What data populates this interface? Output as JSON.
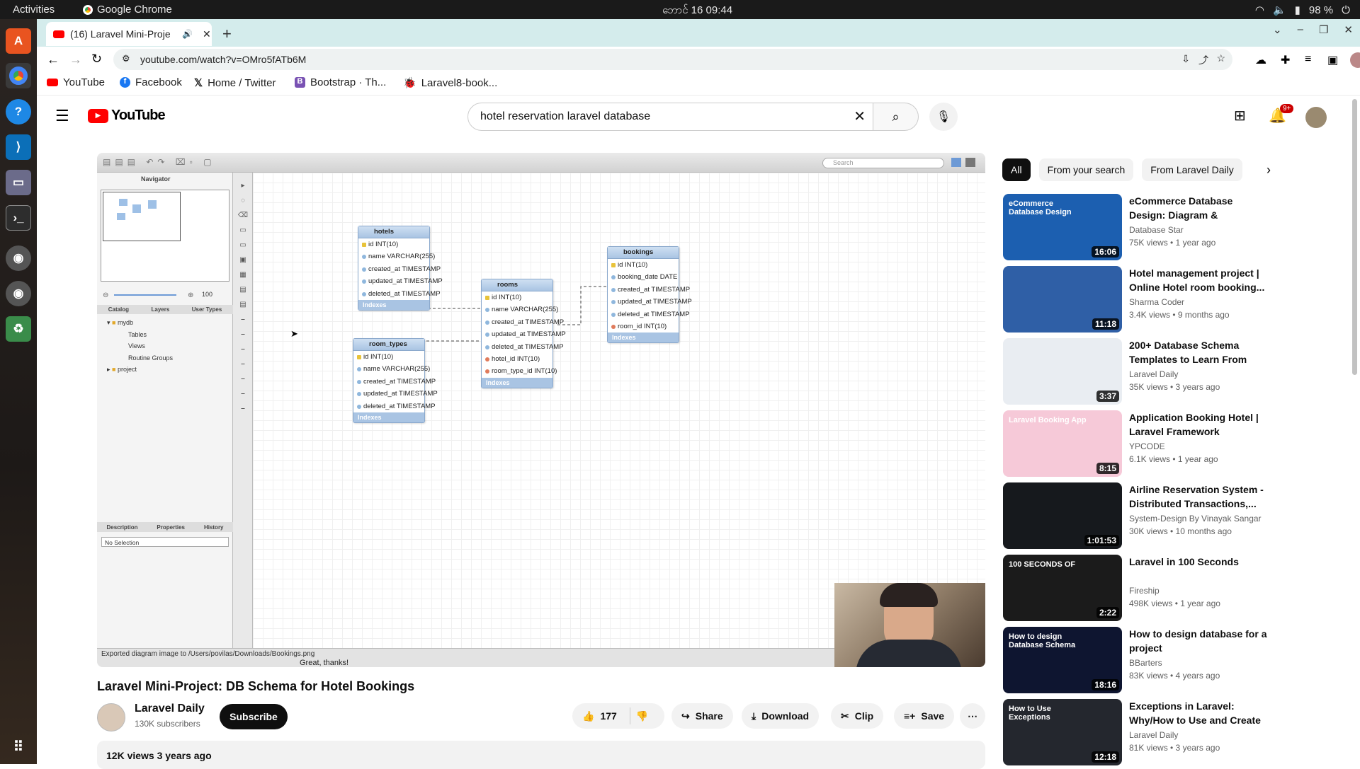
{
  "system": {
    "activities": "Activities",
    "app_name": "Google Chrome",
    "clock": "ဘောင် 16  09:44",
    "battery": "98 %"
  },
  "browser": {
    "tab_title": "(16) Laravel Mini-Proje",
    "url": "youtube.com/watch?v=OMro5fATb6M",
    "bookmarks": [
      "YouTube",
      "Facebook",
      "Home / Twitter",
      "Bootstrap · Th...",
      "Laravel8-book..."
    ]
  },
  "youtube": {
    "logo": "YouTube",
    "search_query": "hotel reservation laravel database",
    "notifications": "9+"
  },
  "video": {
    "navigator_label": "Navigator",
    "search_placeholder": "Search",
    "zoom": "100",
    "panel_tabs": [
      "Catalog",
      "Layers",
      "User Types"
    ],
    "tree": [
      "mydb",
      "Tables",
      "Views",
      "Routine Groups",
      "project"
    ],
    "prop_tabs": [
      "Description",
      "Properties",
      "History"
    ],
    "no_selection": "No Selection",
    "status_text": "Exported diagram image to /Users/povilas/Downloads/Bookings.png",
    "subtitle": "Great, thanks!",
    "tables": {
      "hotels": {
        "name": "hotels",
        "columns": [
          "id INT(10)",
          "name VARCHAR(255)",
          "created_at TIMESTAMP",
          "updated_at TIMESTAMP",
          "deleted_at TIMESTAMP"
        ]
      },
      "rooms": {
        "name": "rooms",
        "columns": [
          "id INT(10)",
          "name VARCHAR(255)",
          "created_at TIMESTAMP",
          "updated_at TIMESTAMP",
          "deleted_at TIMESTAMP",
          "hotel_id INT(10)",
          "room_type_id INT(10)"
        ]
      },
      "bookings": {
        "name": "bookings",
        "columns": [
          "id INT(10)",
          "booking_date DATE",
          "created_at TIMESTAMP",
          "updated_at TIMESTAMP",
          "deleted_at TIMESTAMP",
          "room_id INT(10)"
        ]
      },
      "room_types": {
        "name": "room_types",
        "columns": [
          "id INT(10)",
          "name VARCHAR(255)",
          "created_at TIMESTAMP",
          "updated_at TIMESTAMP",
          "deleted_at TIMESTAMP"
        ]
      },
      "indexes_label": "Indexes"
    }
  },
  "meta": {
    "title": "Laravel Mini-Project: DB Schema for Hotel Bookings",
    "channel": "Laravel Daily",
    "subscribers": "130K subscribers",
    "subscribe": "Subscribe",
    "likes": "177",
    "share": "Share",
    "download": "Download",
    "clip": "Clip",
    "save": "Save",
    "views_date": "12K views  3 years ago"
  },
  "chips": [
    "All",
    "From your search",
    "From Laravel Daily"
  ],
  "recommendations": [
    {
      "title": "eCommerce Database Design: Diagram & Explanation",
      "channel": "Database Star",
      "meta": "75K views • 1 year ago",
      "duration": "16:06",
      "color": "#1c5fb0",
      "thumb_text": "eCommerce Database Design"
    },
    {
      "title": "Hotel management project | Online Hotel room booking...",
      "channel": "Sharma Coder",
      "meta": "3.4K views • 9 months ago",
      "duration": "11:18",
      "color": "#2f5fa6",
      "thumb_text": ""
    },
    {
      "title": "200+ Database Schema Templates to Learn From",
      "channel": "Laravel Daily",
      "meta": "35K views • 3 years ago",
      "duration": "3:37",
      "color": "#e9edf2",
      "thumb_text": ""
    },
    {
      "title": "Application Booking Hotel | Laravel Framework",
      "channel": "YPCODE",
      "meta": "6.1K views • 1 year ago",
      "duration": "8:15",
      "color": "#f6c9d8",
      "thumb_text": "Laravel Booking App"
    },
    {
      "title": "Airline Reservation System - Distributed Transactions,...",
      "channel": "System-Design By Vinayak Sangar",
      "meta": "30K views • 10 months ago",
      "duration": "1:01:53",
      "color": "#16191d",
      "thumb_text": ""
    },
    {
      "title": "Laravel in 100 Seconds",
      "channel": "Fireship",
      "meta": "498K views • 1 year ago",
      "duration": "2:22",
      "color": "#1b1b1b",
      "thumb_text": "100 SECONDS OF"
    },
    {
      "title": "How to design database for a project",
      "channel": "BBarters",
      "meta": "83K views • 4 years ago",
      "duration": "18:16",
      "color": "#0e1530",
      "thumb_text": "How to design Database Schema"
    },
    {
      "title": "Exceptions in Laravel: Why/How to Use and Create Your Own",
      "channel": "Laravel Daily",
      "meta": "81K views • 3 years ago",
      "duration": "12:18",
      "color": "#24272e",
      "thumb_text": "How to Use Exceptions"
    }
  ]
}
